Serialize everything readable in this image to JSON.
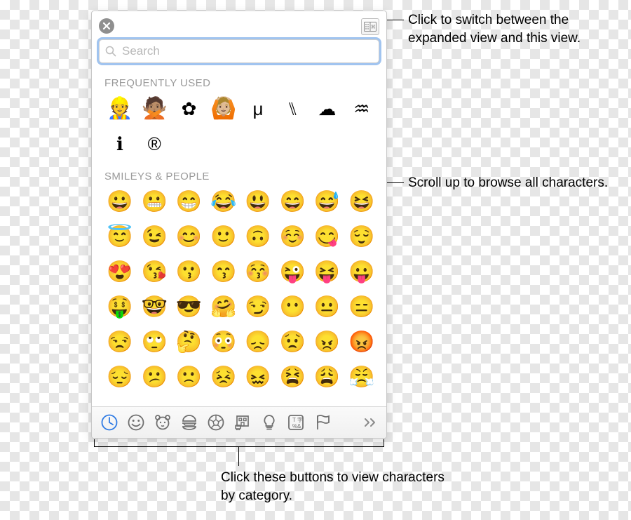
{
  "search": {
    "placeholder": "Search",
    "value": ""
  },
  "sections": {
    "frequently_used": {
      "title": "FREQUENTLY USED",
      "items": [
        "👷",
        "🙅🏽",
        "✿",
        "🙆🏼",
        "μ",
        "⑊",
        "☁︎",
        "♒︎",
        "ℹ",
        "®"
      ]
    },
    "smileys_people": {
      "title": "SMILEYS & PEOPLE",
      "items": [
        "😀",
        "😬",
        "😁",
        "😂",
        "😃",
        "😄",
        "😅",
        "😆",
        "😇",
        "😉",
        "😊",
        "🙂",
        "🙃",
        "☺️",
        "😋",
        "😌",
        "😍",
        "😘",
        "😗",
        "😙",
        "😚",
        "😜",
        "😝",
        "😛",
        "🤑",
        "🤓",
        "😎",
        "🤗",
        "😏",
        "😶",
        "😐",
        "😑",
        "😒",
        "🙄",
        "🤔",
        "😳",
        "😞",
        "😟",
        "😠",
        "😡",
        "😔",
        "😕",
        "🙁",
        "😣",
        "😖",
        "😫",
        "😩",
        "😤"
      ]
    }
  },
  "categories": [
    {
      "id": "clock",
      "label": "Frequently Used",
      "active": true
    },
    {
      "id": "smiley",
      "label": "Smileys & People",
      "active": false
    },
    {
      "id": "animal",
      "label": "Animals & Nature",
      "active": false
    },
    {
      "id": "food",
      "label": "Food & Drink",
      "active": false
    },
    {
      "id": "activity",
      "label": "Activity",
      "active": false
    },
    {
      "id": "travel",
      "label": "Travel & Places",
      "active": false
    },
    {
      "id": "objects",
      "label": "Objects",
      "active": false
    },
    {
      "id": "symbols",
      "label": "Symbols",
      "active": false
    },
    {
      "id": "flags",
      "label": "Flags",
      "active": false
    }
  ],
  "callouts": {
    "expand": "Click to switch between the expanded view and this view.",
    "scroll": "Scroll up to browse all characters.",
    "categories": "Click these buttons to view characters by category."
  }
}
